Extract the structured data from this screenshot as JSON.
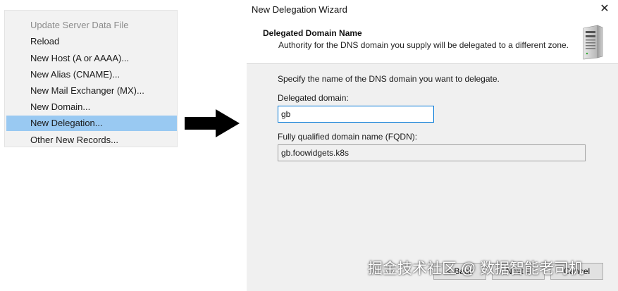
{
  "context_menu": {
    "items": [
      {
        "label": "Update Server Data File",
        "state": "disabled"
      },
      {
        "label": "Reload",
        "state": "normal"
      },
      {
        "label": "New Host (A or AAAA)...",
        "state": "normal"
      },
      {
        "label": "New Alias (CNAME)...",
        "state": "normal"
      },
      {
        "label": "New Mail Exchanger (MX)...",
        "state": "normal"
      },
      {
        "label": "New Domain...",
        "state": "normal"
      },
      {
        "label": "New Delegation...",
        "state": "selected"
      },
      {
        "label": "Other New Records...",
        "state": "normal"
      }
    ],
    "selection_color": "#99c9f2"
  },
  "arrow": {
    "icon": "right-arrow-icon",
    "color": "#000000"
  },
  "wizard": {
    "title": "New Delegation Wizard",
    "close_icon": "close-icon",
    "header": {
      "title": "Delegated Domain Name",
      "subtitle": "Authority for the DNS domain you supply will be delegated to a different zone.",
      "icon": "server-icon"
    },
    "instruction": "Specify the name of the DNS domain you want to delegate.",
    "delegated_domain": {
      "label": "Delegated domain:",
      "value": "gb"
    },
    "fqdn": {
      "label": "Fully qualified domain name (FQDN):",
      "value": "gb.foowidgets.k8s"
    },
    "buttons": {
      "back": "< Back",
      "next": "Next >",
      "cancel": "Cancel"
    },
    "accent_color": "#0078d7"
  },
  "watermark": "掘金技术社区 @ 数据智能老司机"
}
